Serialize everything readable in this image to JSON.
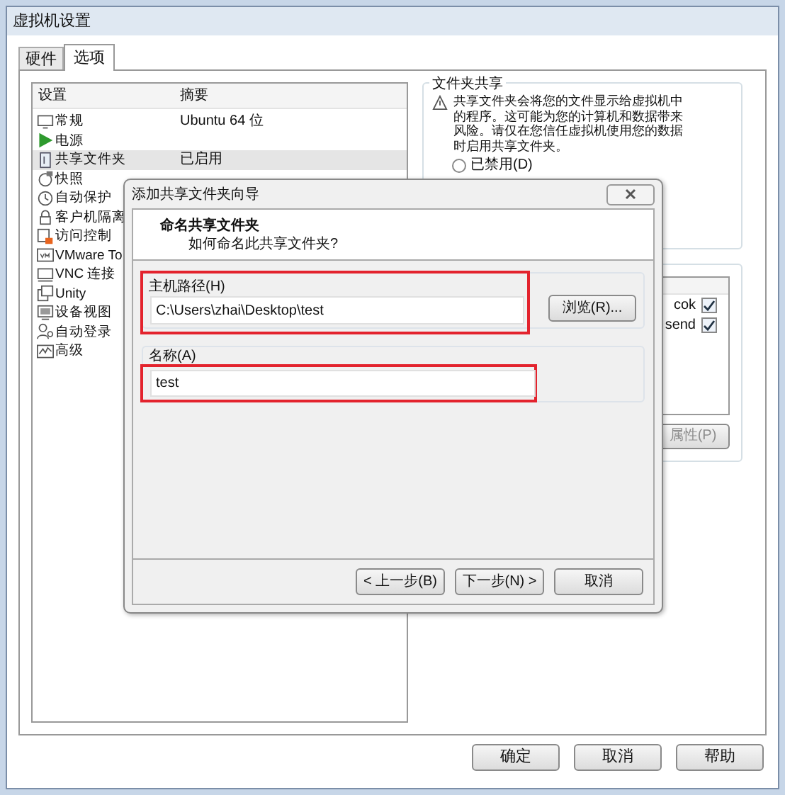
{
  "window": {
    "title": "虚拟机设置"
  },
  "tabs": [
    {
      "label": "硬件",
      "selected": false
    },
    {
      "label": "选项",
      "selected": true
    }
  ],
  "settings_list": {
    "columns": [
      "设置",
      "摘要"
    ],
    "rows": [
      {
        "kind": "monitor",
        "name": "常规",
        "summary": "Ubuntu 64 位",
        "selected": false
      },
      {
        "kind": "play",
        "name": "电源",
        "selected": false
      },
      {
        "kind": "folder",
        "name": "共享文件夹",
        "summary": "已启用",
        "selected": true
      },
      {
        "kind": "camera",
        "name": "快照",
        "selected": false
      },
      {
        "kind": "clock",
        "name": "自动保护",
        "selected": false
      },
      {
        "kind": "lock",
        "name": "客户机隔离",
        "selected": false
      },
      {
        "kind": "access",
        "name": "访问控制",
        "selected": false
      },
      {
        "kind": "vm",
        "name": "VMware To",
        "selected": false
      },
      {
        "kind": "network",
        "name": "VNC 连接",
        "selected": false
      },
      {
        "kind": "windows",
        "name": "Unity",
        "selected": false
      },
      {
        "kind": "device",
        "name": "设备视图",
        "selected": false
      },
      {
        "kind": "user",
        "name": "自动登录",
        "selected": false
      },
      {
        "kind": "chart",
        "name": "高级",
        "selected": false
      }
    ]
  },
  "folder_sharing": {
    "title": "文件夹共享",
    "warning": "共享文件夹会将您的文件显示给虚拟机中的程序。这可能为您的计算机和数据带来风险。请仅在您信任虚拟机使用您的数据时启用共享文件夹。",
    "options": [
      {
        "label": "已禁用(D)",
        "selected": false
      }
    ]
  },
  "folders": {
    "rows": [
      {
        "name": "cok",
        "checked": true
      },
      {
        "name": "send",
        "checked": true
      }
    ],
    "properties_button": {
      "label": "属性(P)",
      "disabled": true
    }
  },
  "buttons": [
    "确定",
    "取消",
    "帮助"
  ],
  "dialog": {
    "title": "添加共享文件夹向导",
    "heading": "命名共享文件夹",
    "subheading": "如何命名此共享文件夹?",
    "host_path": {
      "label": "主机路径(H)",
      "value": "C:\\Users\\zhai\\Desktop\\test",
      "highlighted": true,
      "browse_button": "浏览(R)..."
    },
    "name": {
      "label": "名称(A)",
      "value": "test",
      "highlighted": true
    },
    "buttons": [
      "< 上一步(B)",
      "下一步(N) >",
      "取消"
    ]
  }
}
